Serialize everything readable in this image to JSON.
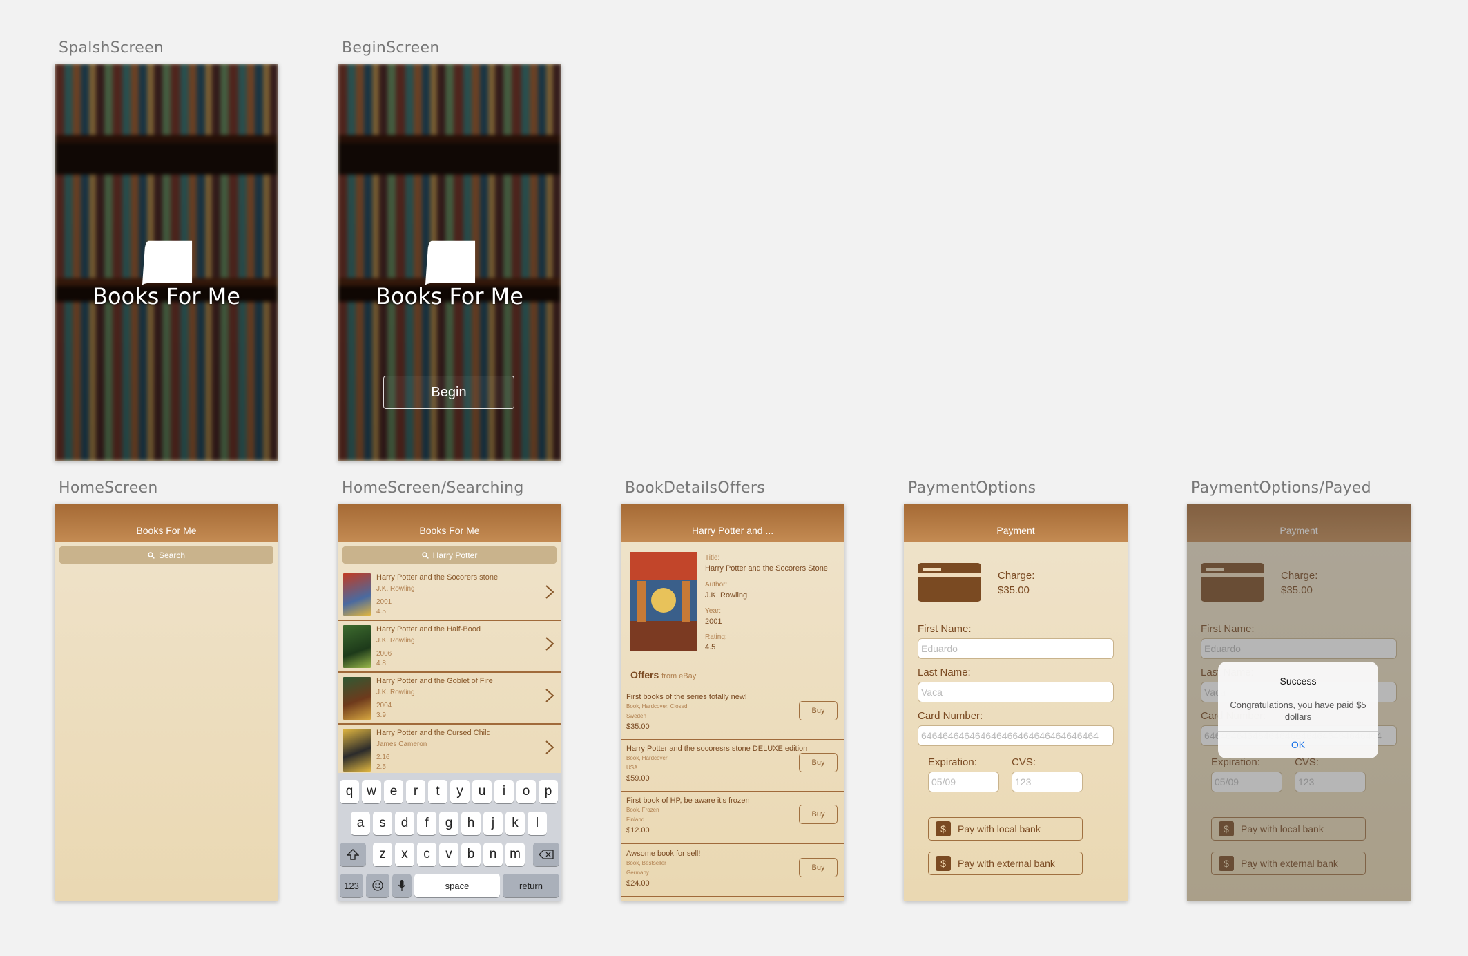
{
  "canvas": {
    "labels": {
      "splash": "SpalshScreen",
      "begin": "BeginScreen",
      "home": "HomeScreen",
      "searching": "HomeScreen/Searching",
      "details": "BookDetailsOffers",
      "payment": "PaymentOptions",
      "payed": "PaymentOptions/Payed"
    }
  },
  "app_name": "Books For Me",
  "begin_button": "Begin",
  "home": {
    "nav_title": "Books For Me",
    "search_placeholder": "Search"
  },
  "searching": {
    "nav_title": "Books For Me",
    "search_value": "Harry Potter",
    "results": [
      {
        "title": "Harry Potter and the Socorers stone",
        "author": "J.K. Rowling",
        "year": "2001",
        "rating": "4.5"
      },
      {
        "title": "Harry Potter and the Half-Bood",
        "author": "J.K. Rowling",
        "year": "2006",
        "rating": "4.8"
      },
      {
        "title": "Harry Potter and the Goblet of Fire",
        "author": "J.K. Rowling",
        "year": "2004",
        "rating": "3.9"
      },
      {
        "title": "Harry Potter and the Cursed Child",
        "author": "James Cameron",
        "year": "2.16",
        "rating": "2.5"
      }
    ],
    "keyboard": {
      "row1": [
        "q",
        "w",
        "e",
        "r",
        "t",
        "y",
        "u",
        "i",
        "o",
        "p"
      ],
      "row2": [
        "a",
        "s",
        "d",
        "f",
        "g",
        "h",
        "j",
        "k",
        "l"
      ],
      "row3": [
        "z",
        "x",
        "c",
        "v",
        "b",
        "n",
        "m"
      ],
      "numbers": "123",
      "space": "space",
      "return": "return"
    }
  },
  "details": {
    "nav_title": "Harry Potter and ...",
    "fields": {
      "title_label": "Title:",
      "title": "Harry Potter and the Socorers Stone",
      "author_label": "Author:",
      "author": "J.K. Rowling",
      "year_label": "Year:",
      "year": "2001",
      "rating_label": "Rating:",
      "rating": "4.5"
    },
    "offers_heading": "Offers",
    "offers_source": "from eBay",
    "buy_label": "Buy",
    "offers": [
      {
        "title": "First books of the series totally new!",
        "desc": "Book, Hardcover, Closed",
        "country": "Sweden",
        "price": "$35.00"
      },
      {
        "title": "Harry Potter and the socoresrs stone DELUXE edition",
        "desc": "Book, Hardcover",
        "country": "USA",
        "price": "$59.00"
      },
      {
        "title": "First book of HP, be aware it's frozen",
        "desc": "Book, Frozen",
        "country": "Finland",
        "price": "$12.00"
      },
      {
        "title": "Awsome book for sell!",
        "desc": "Book, Bestseller",
        "country": "Germany",
        "price": "$24.00"
      }
    ]
  },
  "payment": {
    "nav_title": "Payment",
    "charge_label": "Charge:",
    "charge_value": "$35.00",
    "first_name_label": "First Name:",
    "first_name_placeholder": "Eduardo",
    "last_name_label": "Last Name:",
    "last_name_placeholder": "Vaca",
    "card_label": "Card Number:",
    "card_placeholder": "646464646464646466464646464646464",
    "expiration_label": "Expiration:",
    "expiration_placeholder": "05/09",
    "cvs_label": "CVS:",
    "cvs_placeholder": "123",
    "local_bank": "Pay with local bank",
    "external_bank": "Pay with external bank",
    "dollar_icon": "$"
  },
  "alert": {
    "title": "Success",
    "message": "Congratulations, you have paid $5 dollars",
    "ok": "OK"
  },
  "colors": {
    "nav": "#a56a35",
    "accent": "#7a4a22",
    "background": "#f2f2f2",
    "link": "#1a73e8"
  }
}
